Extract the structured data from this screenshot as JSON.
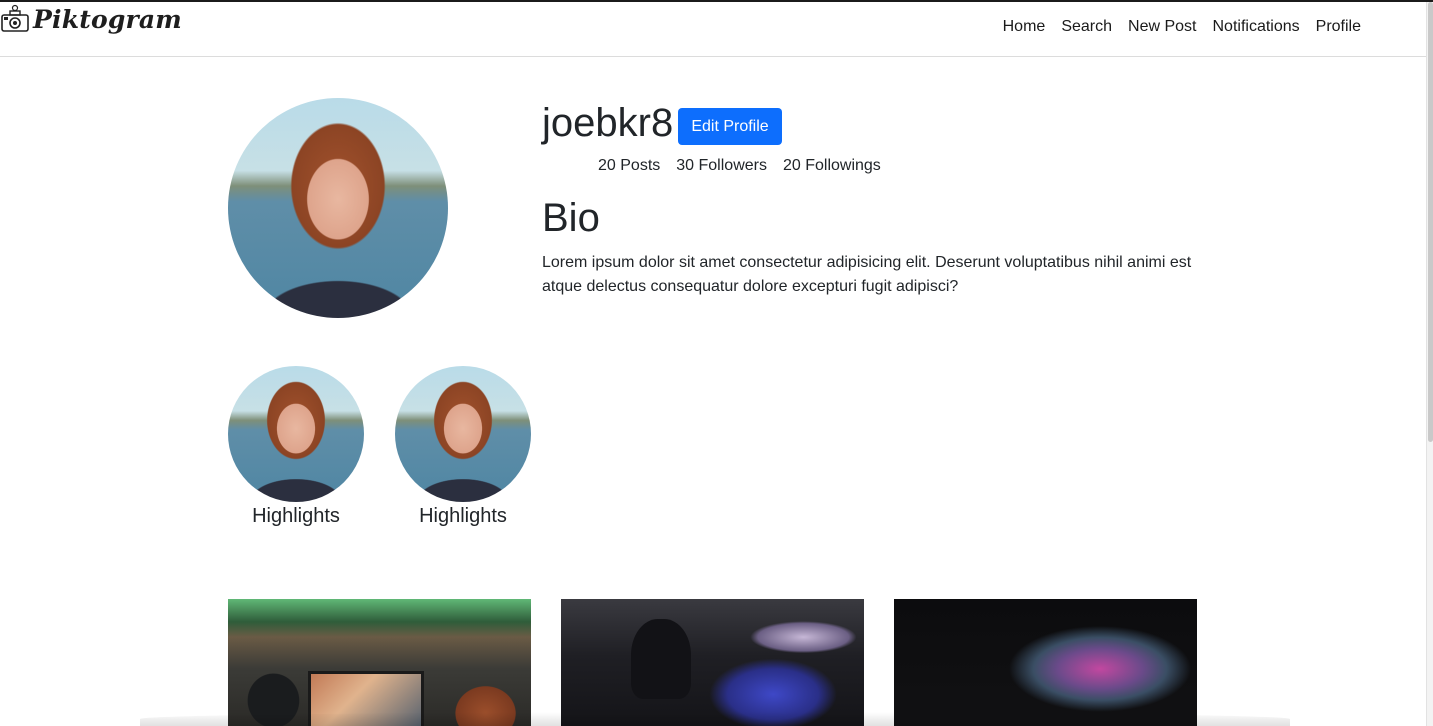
{
  "app": {
    "brand": "Piktogram",
    "logo_icon": "camera-icon"
  },
  "nav": {
    "items": [
      {
        "label": "Home"
      },
      {
        "label": "Search"
      },
      {
        "label": "New Post"
      },
      {
        "label": "Notifications"
      },
      {
        "label": "Profile"
      }
    ]
  },
  "profile": {
    "username": "joebkr8",
    "edit_label": "Edit Profile",
    "posts": "20 Posts",
    "followers": "30 Followers",
    "followings": "20 Followings",
    "bio_heading": "Bio",
    "bio_text": "Lorem ipsum dolor sit amet consectetur adipisicing elit. Deserunt voluptatibus nihil animi est atque delectus consequatur dolore excepturi fugit adipisci?"
  },
  "highlights": [
    {
      "label": "Highlights"
    },
    {
      "label": "Highlights"
    }
  ],
  "posts": [
    {
      "description": "gaming-room"
    },
    {
      "description": "esports-arena"
    },
    {
      "description": "blurred-screen"
    }
  ],
  "colors": {
    "accent": "#0d6efd",
    "text": "#212529"
  }
}
